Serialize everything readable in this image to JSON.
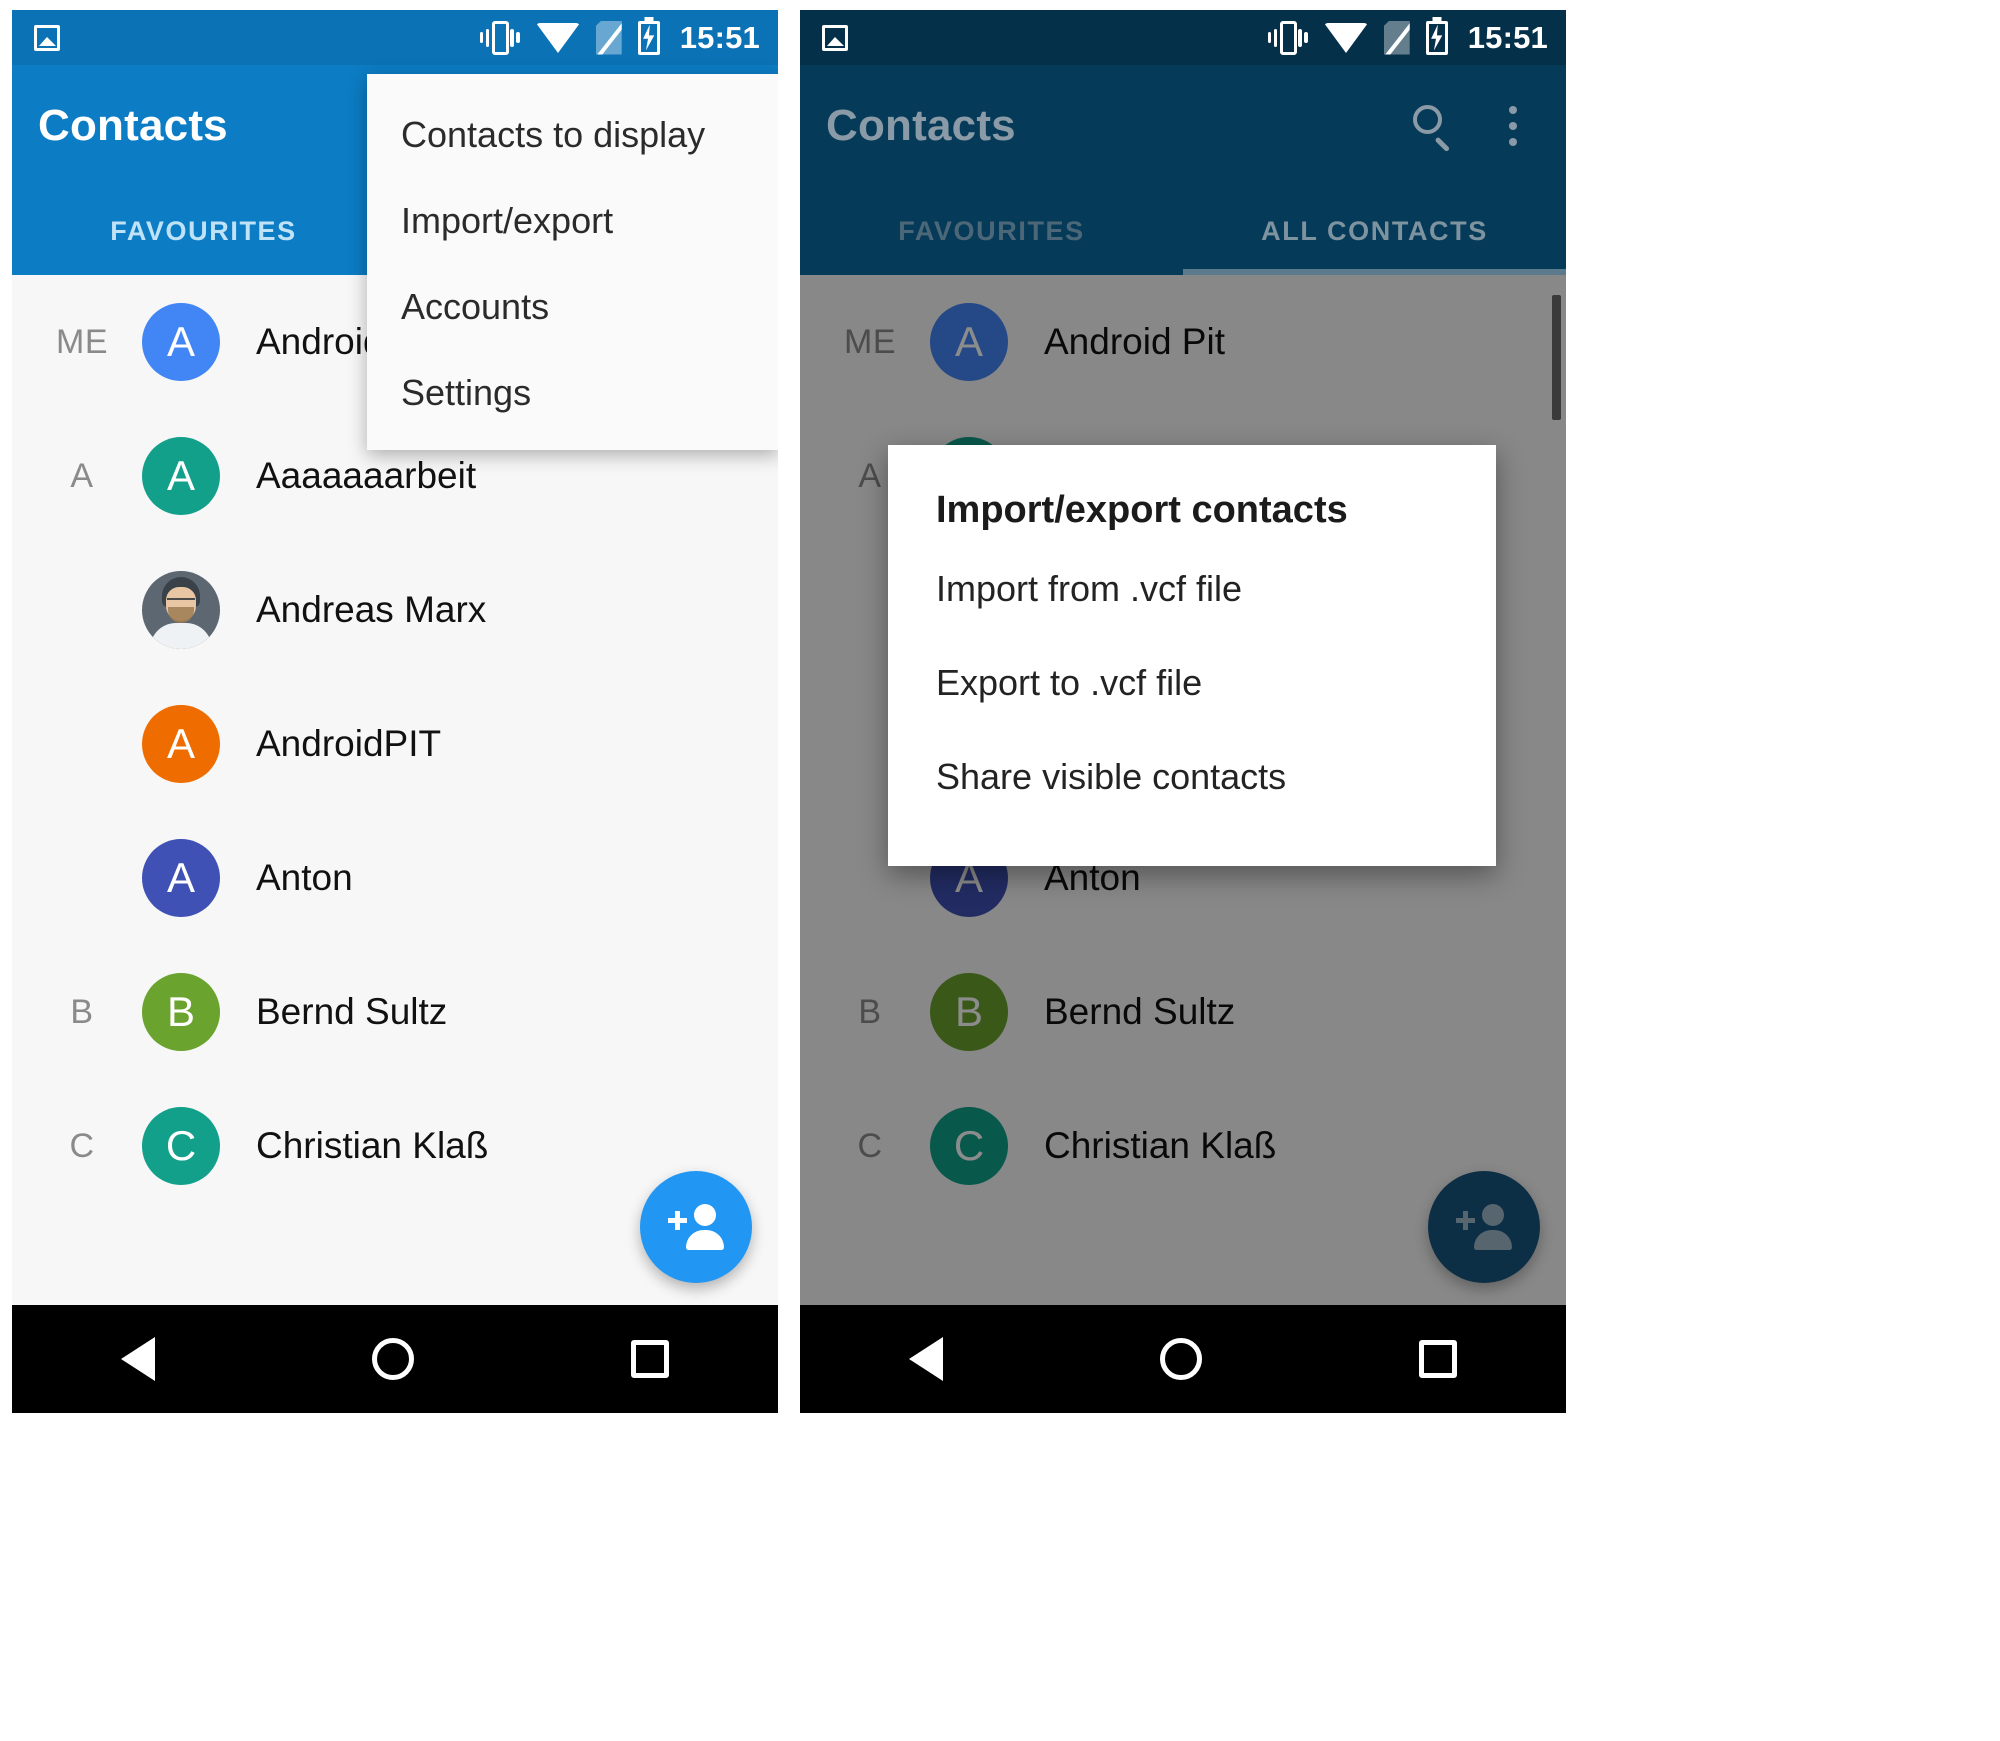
{
  "statusbar": {
    "time": "15:51",
    "icons": [
      "photo-icon",
      "vibrate-icon",
      "wifi-icon",
      "sim-off-icon",
      "battery-charging-icon"
    ]
  },
  "colors": {
    "accent_blue": "#0c7cc4",
    "status_blue": "#0b72b5",
    "dim_navy": "#063a59",
    "dim_navy_status": "#053049",
    "list_bg": "#f7f7f7",
    "nav_black": "#000000",
    "fab_blue": "#2196f3",
    "fab_dim": "#19567e"
  },
  "left_panel": {
    "appbar": {
      "title": "Contacts"
    },
    "tabs": [
      {
        "label": "FAVOURITES",
        "active": false
      },
      {
        "label": "ALL CONTACTS",
        "active": true
      }
    ],
    "overflow_menu": {
      "items": [
        {
          "label": "Contacts to display"
        },
        {
          "label": "Import/export"
        },
        {
          "label": "Accounts"
        },
        {
          "label": "Settings"
        }
      ]
    },
    "contacts": [
      {
        "index": "ME",
        "name": "Android Pit",
        "initial": "A",
        "color": "#4285f4",
        "photo": false
      },
      {
        "index": "A",
        "name": "Aaaaaaarbeit",
        "initial": "A",
        "color": "#12a08a",
        "photo": false
      },
      {
        "index": "",
        "name": "Andreas Marx",
        "initial": "",
        "color": "#5d6771",
        "photo": true
      },
      {
        "index": "",
        "name": "AndroidPIT",
        "initial": "A",
        "color": "#ef6c00",
        "photo": false
      },
      {
        "index": "",
        "name": "Anton",
        "initial": "A",
        "color": "#3f51b5",
        "photo": false
      },
      {
        "index": "B",
        "name": "Bernd Sultz",
        "initial": "B",
        "color": "#6aa32e",
        "photo": false
      },
      {
        "index": "C",
        "name": "Christian Klaß",
        "initial": "C",
        "color": "#12a08a",
        "photo": false
      }
    ],
    "fab": {
      "icon": "add-person-icon"
    },
    "navbar": {
      "back": "back-icon",
      "home": "home-icon",
      "recents": "recents-icon"
    }
  },
  "right_panel": {
    "appbar": {
      "title": "Contacts",
      "search_icon": "search-icon",
      "overflow_icon": "more-vertical-icon"
    },
    "tabs": [
      {
        "label": "FAVOURITES",
        "active": false
      },
      {
        "label": "ALL CONTACTS",
        "active": true
      }
    ],
    "dialog": {
      "title": "Import/export contacts",
      "items": [
        {
          "label": "Import from .vcf file"
        },
        {
          "label": "Export to .vcf file"
        },
        {
          "label": "Share visible contacts"
        }
      ]
    },
    "contacts": [
      {
        "index": "ME",
        "name": "Android Pit",
        "initial": "A",
        "color": "#4285f4",
        "photo": false
      },
      {
        "index": "A",
        "name": "Aaaaaaarbeit",
        "initial": "A",
        "color": "#12a08a",
        "photo": false
      },
      {
        "index": "",
        "name": "Andreas Marx",
        "initial": "",
        "color": "#5d6771",
        "photo": true
      },
      {
        "index": "",
        "name": "AndroidPIT",
        "initial": "A",
        "color": "#ef6c00",
        "photo": false
      },
      {
        "index": "",
        "name": "Anton",
        "initial": "A",
        "color": "#3f51b5",
        "photo": false
      },
      {
        "index": "B",
        "name": "Bernd Sultz",
        "initial": "B",
        "color": "#6aa32e",
        "photo": false
      },
      {
        "index": "C",
        "name": "Christian Klaß",
        "initial": "C",
        "color": "#12a08a",
        "photo": false
      }
    ],
    "fab": {
      "icon": "add-person-icon"
    },
    "navbar": {
      "back": "back-icon",
      "home": "home-icon",
      "recents": "recents-icon"
    }
  }
}
